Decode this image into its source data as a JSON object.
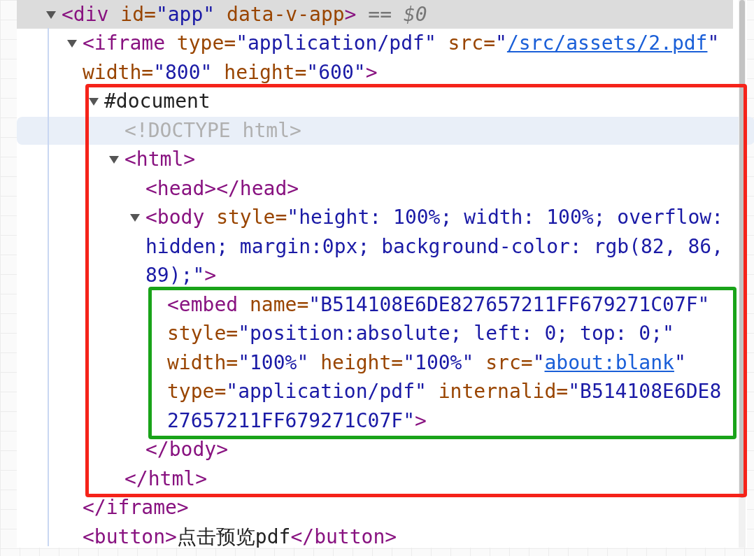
{
  "tree": [
    {
      "selected": true,
      "hovered": false,
      "expanded": true,
      "lines": [
        [
          {
            "kind": "tag",
            "text": "<div "
          },
          {
            "kind": "attr",
            "text": "id="
          },
          {
            "kind": "value",
            "text": "\"app\" "
          },
          {
            "kind": "attr",
            "text": "data-v-app"
          },
          {
            "kind": "tag",
            "text": ">"
          },
          {
            "kind": "comment",
            "text": " == $0"
          }
        ]
      ],
      "children": [
        {
          "selected": false,
          "hovered": false,
          "expanded": true,
          "lines": [
            [
              {
                "kind": "tag",
                "text": "<iframe "
              },
              {
                "kind": "attr",
                "text": "type="
              },
              {
                "kind": "value",
                "text": "\"application/pdf\" "
              },
              {
                "kind": "attr",
                "text": "src="
              },
              {
                "kind": "value",
                "text": "\""
              },
              {
                "kind": "link",
                "text": "/src/assets/2.pdf"
              },
              {
                "kind": "value",
                "text": "\""
              }
            ],
            [
              {
                "kind": "attr",
                "text": "width="
              },
              {
                "kind": "value",
                "text": "\"800\" "
              },
              {
                "kind": "attr",
                "text": "height="
              },
              {
                "kind": "value",
                "text": "\"600\""
              },
              {
                "kind": "tag",
                "text": ">"
              }
            ]
          ],
          "closing": [
            {
              "kind": "tag",
              "text": "</iframe>"
            }
          ],
          "children": [
            {
              "selected": false,
              "hovered": false,
              "expanded": true,
              "frame": {
                "color": "#f5231a"
              },
              "lines": [
                [
                  {
                    "kind": "plain",
                    "text": "#document"
                  }
                ]
              ],
              "children": [
                {
                  "selected": false,
                  "hovered": true,
                  "lines": [
                    [
                      {
                        "kind": "doctype",
                        "text": "<!DOCTYPE html>"
                      }
                    ]
                  ]
                },
                {
                  "selected": false,
                  "hovered": false,
                  "expanded": true,
                  "lines": [
                    [
                      {
                        "kind": "tag",
                        "text": "<html>"
                      }
                    ]
                  ],
                  "closing": [
                    {
                      "kind": "tag",
                      "text": "</html>"
                    }
                  ],
                  "children": [
                    {
                      "selected": false,
                      "hovered": false,
                      "lines": [
                        [
                          {
                            "kind": "tag",
                            "text": "<head></head>"
                          }
                        ]
                      ]
                    },
                    {
                      "selected": false,
                      "hovered": false,
                      "expanded": true,
                      "lines": [
                        [
                          {
                            "kind": "tag",
                            "text": "<body "
                          },
                          {
                            "kind": "attr",
                            "text": "style="
                          },
                          {
                            "kind": "value",
                            "text": "\"height: 100%; width: 100%; overflow:"
                          }
                        ],
                        [
                          {
                            "kind": "value",
                            "text": "hidden; margin:0px; background-color: rgb(82, 86,"
                          }
                        ],
                        [
                          {
                            "kind": "value",
                            "text": "89);\""
                          },
                          {
                            "kind": "tag",
                            "text": ">"
                          }
                        ]
                      ],
                      "closing": [
                        {
                          "kind": "tag",
                          "text": "</body>"
                        }
                      ],
                      "children": [
                        {
                          "selected": false,
                          "hovered": false,
                          "frame": {
                            "color": "#19a319"
                          },
                          "lines": [
                            [
                              {
                                "kind": "tag",
                                "text": "<embed "
                              },
                              {
                                "kind": "attr",
                                "text": "name="
                              },
                              {
                                "kind": "value",
                                "text": "\"B514108E6DE827657211FF679271C07F\""
                              }
                            ],
                            [
                              {
                                "kind": "attr",
                                "text": "style="
                              },
                              {
                                "kind": "value",
                                "text": "\"position:absolute; left: 0; top: 0;\""
                              }
                            ],
                            [
                              {
                                "kind": "attr",
                                "text": "width="
                              },
                              {
                                "kind": "value",
                                "text": "\"100%\" "
                              },
                              {
                                "kind": "attr",
                                "text": "height="
                              },
                              {
                                "kind": "value",
                                "text": "\"100%\" "
                              },
                              {
                                "kind": "attr",
                                "text": "src="
                              },
                              {
                                "kind": "value",
                                "text": "\""
                              },
                              {
                                "kind": "link",
                                "text": "about:blank"
                              },
                              {
                                "kind": "value",
                                "text": "\""
                              }
                            ],
                            [
                              {
                                "kind": "attr",
                                "text": "type="
                              },
                              {
                                "kind": "value",
                                "text": "\"application/pdf\" "
                              },
                              {
                                "kind": "attr",
                                "text": "internalid="
                              },
                              {
                                "kind": "value",
                                "text": "\"B514108E6DE8"
                              }
                            ],
                            [
                              {
                                "kind": "value",
                                "text": "27657211FF679271C07F\""
                              },
                              {
                                "kind": "tag",
                                "text": ">"
                              }
                            ]
                          ]
                        }
                      ]
                    }
                  ]
                }
              ]
            }
          ]
        },
        {
          "selected": false,
          "hovered": false,
          "lines": [
            [
              {
                "kind": "tag",
                "text": "<button>"
              },
              {
                "kind": "plain",
                "text": "点击预览pdf"
              },
              {
                "kind": "tag",
                "text": "</button>"
              }
            ]
          ]
        }
      ]
    }
  ]
}
